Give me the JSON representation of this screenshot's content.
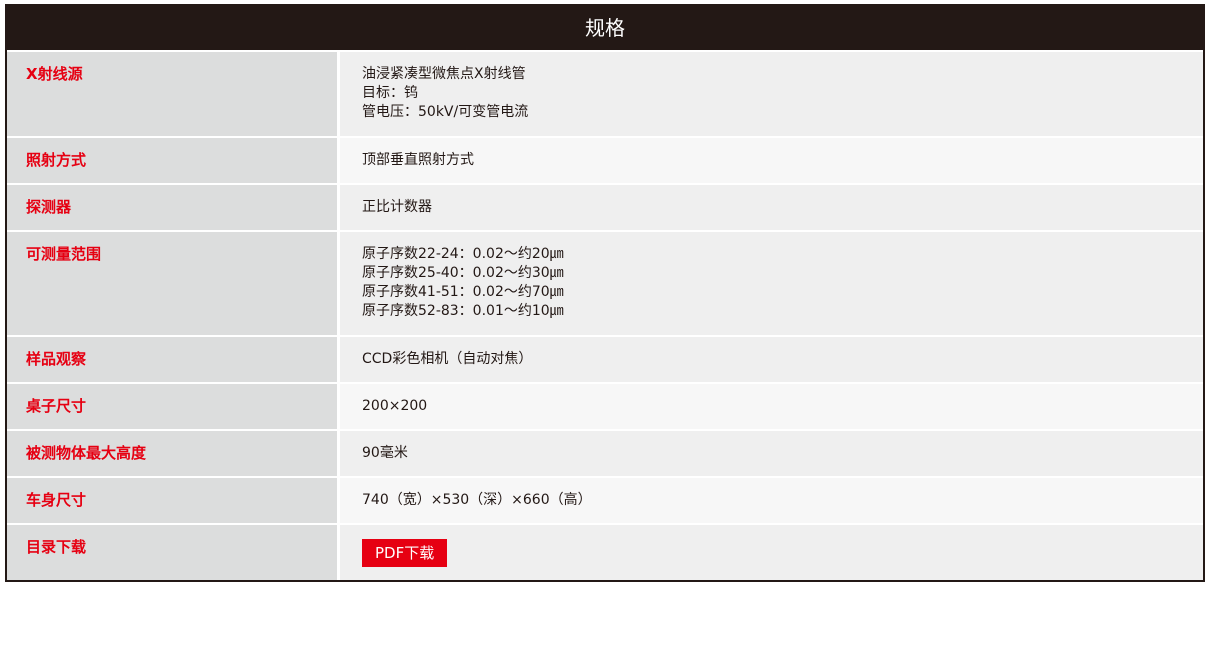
{
  "table": {
    "header": "规格",
    "rows": [
      {
        "label": "X射线源",
        "lines": [
          "油浸紧凑型微焦点X射线管",
          "目标：钨",
          "管电压：50kV/可变管电流"
        ]
      },
      {
        "label": "照射方式",
        "lines": [
          "顶部垂直照射方式"
        ]
      },
      {
        "label": "探测器",
        "lines": [
          "正比计数器"
        ]
      },
      {
        "label": "可测量范围",
        "lines": [
          "原子序数22-24：0.02～约20㎛",
          "原子序数25-40：0.02～约30㎛",
          "原子序数41-51：0.02～约70㎛",
          "原子序数52-83：0.01～约10㎛"
        ]
      },
      {
        "label": "样品观察",
        "lines": [
          "CCD彩色相机（自动对焦）"
        ]
      },
      {
        "label": "桌子尺寸",
        "lines": [
          "200×200"
        ]
      },
      {
        "label": "被测物体最大高度",
        "lines": [
          "90毫米"
        ]
      },
      {
        "label": "车身尺寸",
        "lines": [
          "740（宽）×530（深）×660（高）"
        ]
      },
      {
        "label": "目录下载",
        "button": "PDF下载"
      }
    ]
  },
  "colors": {
    "header_bg": "#231815",
    "label_text": "#e60012",
    "label_bg": "#dcdddd",
    "value_bg": "#efefef",
    "value_bg_alt": "#f7f7f7",
    "button_bg": "#e60012"
  }
}
